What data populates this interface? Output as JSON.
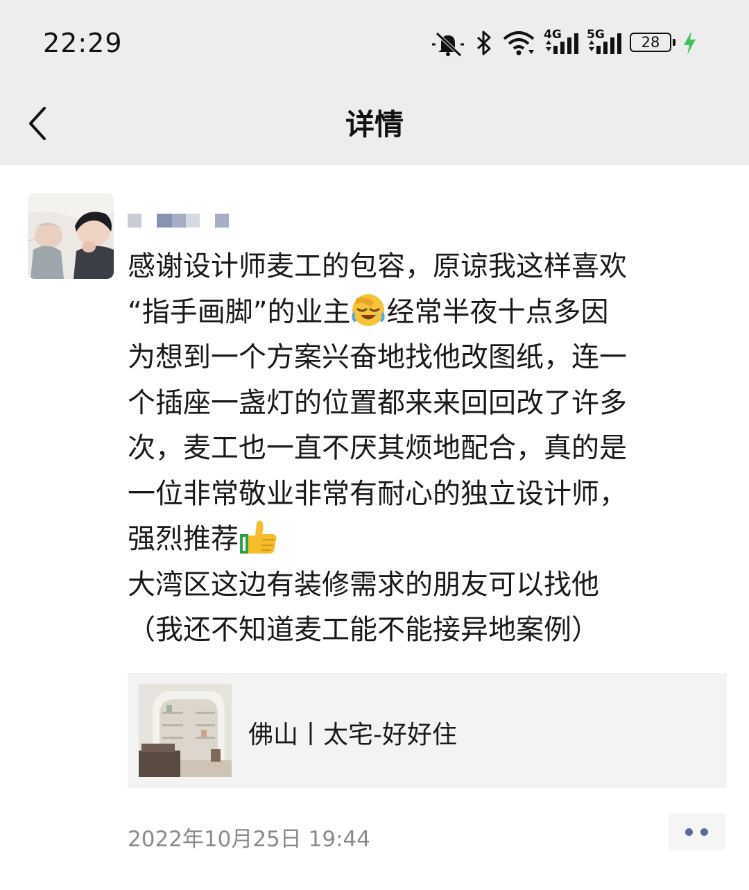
{
  "status_bar": {
    "time": "22:29",
    "signal_1_label": "4G",
    "signal_2_label": "5G",
    "battery": "28",
    "icons": [
      "mute-bell-icon",
      "bluetooth-icon",
      "wifi-icon",
      "signal-4g-icon",
      "signal-5g-icon",
      "battery-icon",
      "charging-icon"
    ]
  },
  "nav": {
    "title": "详情",
    "back_icon": "chevron-left-icon"
  },
  "post": {
    "lines": [
      "感谢设计师麦工的包容，原谅我这样喜欢",
      "“指手画脚”的业主",
      "经常半夜十点多因",
      "为想到一个方案兴奋地找他改图纸，连一",
      "个插座一盏灯的位置都来来回回改了许多",
      "次，麦工也一直不厌其烦地配合，真的是",
      "一位非常敬业非常有耐心的独立设计师，",
      "强烈推荐",
      "大湾区这边有装修需求的朋友可以找他",
      "（我还不知道麦工能不能接异地案例）"
    ],
    "emojis": [
      "facepalm-laughing-emoji",
      "thumbs-up-emoji"
    ],
    "link": {
      "title": "佛山丨太宅-好好住"
    },
    "timestamp": "2022年10月25日 19:44",
    "more_icon": "more-dots-icon"
  },
  "colors": {
    "header_bg": "#ededed",
    "link_card_bg": "#f3f3f3",
    "timestamp": "#8a8a8a",
    "accent": "#576b95",
    "charging": "#3cc45a"
  }
}
